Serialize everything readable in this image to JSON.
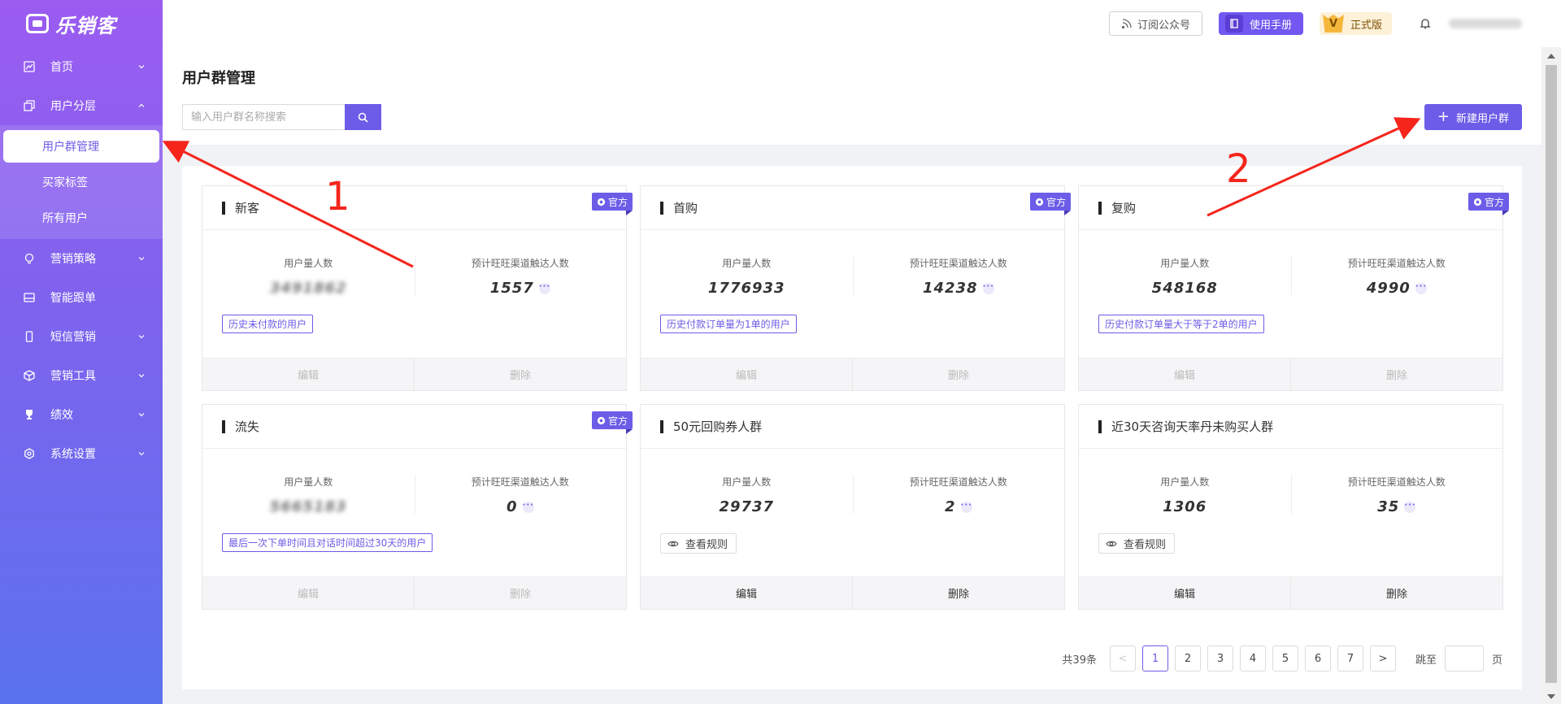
{
  "app": {
    "logo_text": "乐销客"
  },
  "sidebar": {
    "items": [
      {
        "label": "首页",
        "icon": "chart-icon"
      },
      {
        "label": "用户分层",
        "icon": "layers-icon",
        "expanded": true,
        "children": [
          {
            "label": "用户群管理",
            "active": true
          },
          {
            "label": "买家标签"
          },
          {
            "label": "所有用户"
          }
        ]
      },
      {
        "label": "营销策略",
        "icon": "bulb-icon"
      },
      {
        "label": "智能跟单",
        "icon": "inbox-icon"
      },
      {
        "label": "短信营销",
        "icon": "phone-icon"
      },
      {
        "label": "营销工具",
        "icon": "cube-icon"
      },
      {
        "label": "绩效",
        "icon": "trophy-icon"
      },
      {
        "label": "系统设置",
        "icon": "settings-icon"
      }
    ]
  },
  "header": {
    "subscribe_label": "订阅公众号",
    "manual_label": "使用手册",
    "official_label": "正式版",
    "official_letter": "V"
  },
  "page": {
    "title": "用户群管理",
    "search_placeholder": "输入用户群名称搜索",
    "new_button_label": "新建用户群"
  },
  "card_labels": {
    "official": "官方",
    "stat1": "用户量人数",
    "stat2": "预计旺旺渠道触达人数",
    "edit": "编辑",
    "delete": "删除",
    "view_rule": "查看规则"
  },
  "cards": [
    {
      "name": "新客",
      "official": true,
      "users": "3491862",
      "users_blurred": true,
      "reach": "1557",
      "rule": "历史未付款的用户",
      "enabled": false
    },
    {
      "name": "首购",
      "official": true,
      "users": "1776933",
      "reach": "14238",
      "rule": "历史付款订单量为1单的用户",
      "enabled": false
    },
    {
      "name": "复购",
      "official": true,
      "users": "548168",
      "reach": "4990",
      "rule": "历史付款订单量大于等于2单的用户",
      "enabled": false
    },
    {
      "name": "流失",
      "official": true,
      "users": "5665183",
      "users_blurred": true,
      "reach": "0",
      "rule": "最后一次下单时间且对话时间超过30天的用户",
      "enabled": false
    },
    {
      "name": "50元回购券人群",
      "official": false,
      "users": "29737",
      "reach": "2",
      "view_rule": true,
      "enabled": true
    },
    {
      "name": "近30天咨询天率丹未购买人群",
      "official": false,
      "users": "1306",
      "reach": "35",
      "view_rule": true,
      "enabled": true
    }
  ],
  "pagination": {
    "total": "共39条",
    "prev": "<",
    "next": ">",
    "pages": [
      "1",
      "2",
      "3",
      "4",
      "5",
      "6",
      "7"
    ],
    "current": "1",
    "jump_label": "跳至",
    "page_unit": "页"
  },
  "annotations": [
    {
      "label": "1"
    },
    {
      "label": "2"
    }
  ],
  "colors": {
    "accent": "#6c5ce7",
    "arrow": "#f5251c"
  }
}
